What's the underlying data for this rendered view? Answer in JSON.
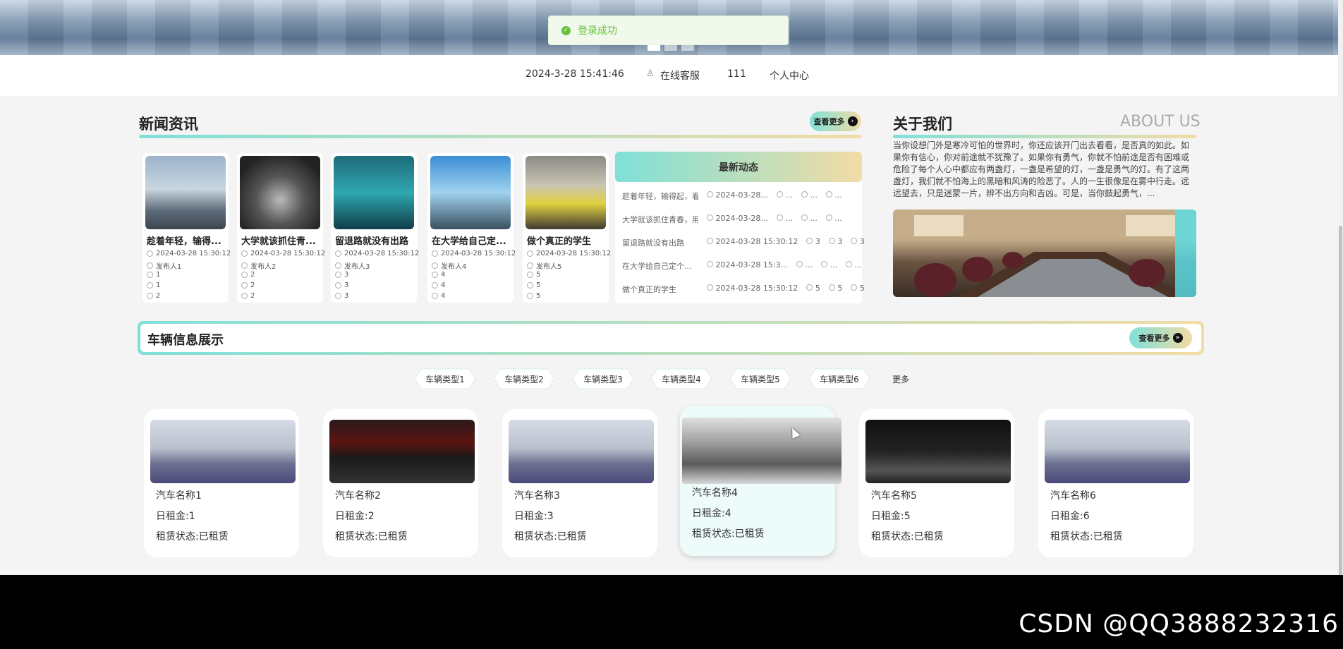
{
  "toast": {
    "text": "登录成功",
    "icon": "check-circle-icon"
  },
  "topbar": {
    "datetime": "2024-3-28 15:41:46",
    "service": "在线客服",
    "user": "111",
    "center": "个人中心",
    "service_icon": "person-icon"
  },
  "news": {
    "title": "新闻资讯",
    "more": "查看更多",
    "cards": [
      {
        "title": "趁着年轻，输得...",
        "date": "2024-03-28 15:30:12",
        "author": "发布人1",
        "likes": "1",
        "collects": "1",
        "views": "2"
      },
      {
        "title": "大学就该抓住青...",
        "date": "2024-03-28 15:30:12",
        "author": "发布人2",
        "likes": "2",
        "collects": "2",
        "views": "2"
      },
      {
        "title": "留退路就没有出路",
        "date": "2024-03-28 15:30:12",
        "author": "发布人3",
        "likes": "3",
        "collects": "3",
        "views": "3"
      },
      {
        "title": "在大学给自己定...",
        "date": "2024-03-28 15:30:12",
        "author": "发布人4",
        "likes": "4",
        "collects": "4",
        "views": "4"
      },
      {
        "title": "做个真正的学生",
        "date": "2024-03-28 15:30:12",
        "author": "发布人5",
        "likes": "5",
        "collects": "5",
        "views": "5"
      }
    ],
    "latest": {
      "title": "最新动态",
      "rows": [
        {
          "title": "趁着年轻，输得起，看...",
          "date": "2024-03-28...",
          "a": "...",
          "b": "...",
          "c": "..."
        },
        {
          "title": "大学就该抓住青春，用...",
          "date": "2024-03-28...",
          "a": "...",
          "b": "...",
          "c": "..."
        },
        {
          "title": "留退路就没有出路",
          "date": "2024-03-28 15:30:12",
          "a": "3",
          "b": "3",
          "c": "3"
        },
        {
          "title": "在大学给自己定个...",
          "date": "2024-03-28 15:3...",
          "a": "...",
          "b": "...",
          "c": "..."
        },
        {
          "title": "做个真正的学生",
          "date": "2024-03-28 15:30:12",
          "a": "5",
          "b": "5",
          "c": "5"
        }
      ]
    }
  },
  "about": {
    "title": "关于我们",
    "title_en": "ABOUT US",
    "text": "当你设想门外是寒冷可怕的世界时，你还应该开门出去看看，是否真的如此。如果你有信心，你对前途就不犹豫了。如果你有勇气，你就不怕前途是否有困难或危险了每个人心中都应有两盏灯，一盏是希望的灯，一盏是勇气的灯。有了这两盏灯，我们就不怕海上的黑暗和风涛的险恶了。人的一生很像是在雾中行走。远远望去，只是迷蒙一片，辨不出方向和吉凶。可是，当你鼓起勇气，..."
  },
  "vehicles": {
    "title": "车辆信息展示",
    "more": "查看更多",
    "tabs": [
      "车辆类型1",
      "车辆类型2",
      "车辆类型3",
      "车辆类型4",
      "车辆类型5",
      "车辆类型6",
      "更多"
    ],
    "cards": [
      {
        "name": "汽车名称1",
        "rent": "日租金:1",
        "status": "租赁状态:已租赁"
      },
      {
        "name": "汽车名称2",
        "rent": "日租金:2",
        "status": "租赁状态:已租赁"
      },
      {
        "name": "汽车名称3",
        "rent": "日租金:3",
        "status": "租赁状态:已租赁"
      },
      {
        "name": "汽车名称4",
        "rent": "日租金:4",
        "status": "租赁状态:已租赁"
      },
      {
        "name": "汽车名称5",
        "rent": "日租金:5",
        "status": "租赁状态:已租赁"
      },
      {
        "name": "汽车名称6",
        "rent": "日租金:6",
        "status": "租赁状态:已租赁"
      }
    ]
  },
  "watermark": "CSDN @QQ3888232316",
  "colors": {
    "accent_start": "#7fe0d8",
    "accent_end": "#f1dca5",
    "success": "#67c23a"
  }
}
